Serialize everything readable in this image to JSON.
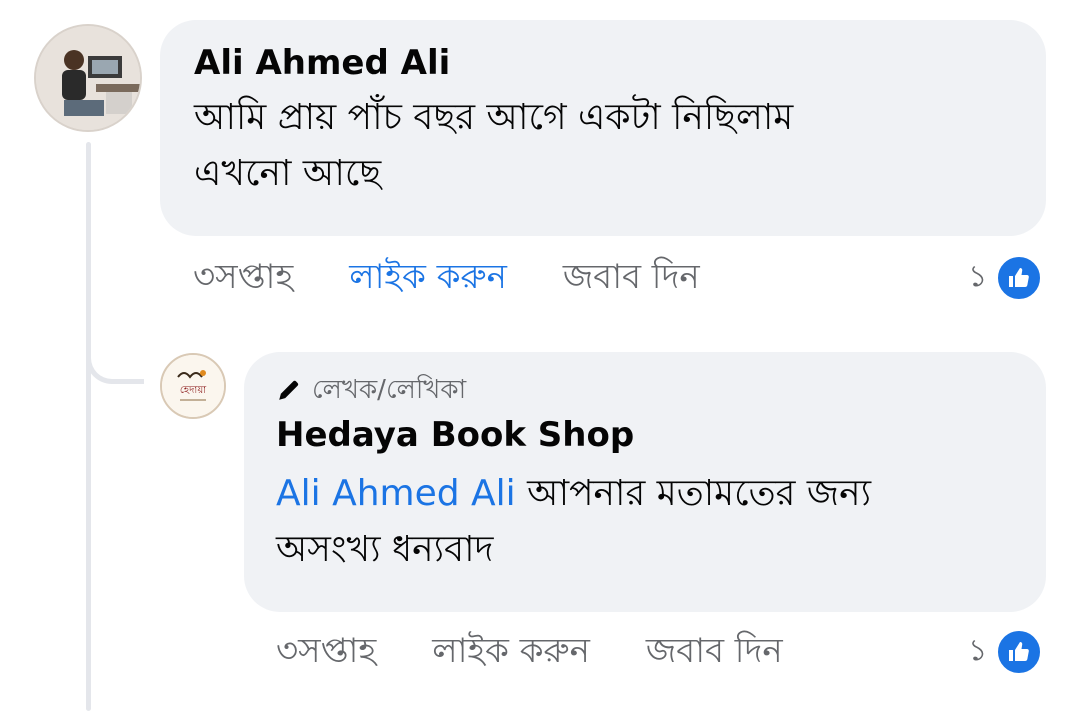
{
  "comment": {
    "author": "Ali Ahmed Ali",
    "text_line1": "আমি প্রায় পাঁচ বছর আগে একটা নিছিলাম",
    "text_line2": "এখনো আছে",
    "time": "৩সপ্তাহ",
    "like_label": "লাইক করুন",
    "reply_label": "জবাব দিন",
    "reaction_count": "১"
  },
  "reply": {
    "badge_label": "লেখক/লেখিকা",
    "author": "Hedaya Book Shop",
    "mention": "Ali Ahmed Ali",
    "text_line1": "আপনার মতামতের জন্য",
    "text_line2": "অসংখ্য ধন্যবাদ",
    "avatar_logo_text": "হেদায়া",
    "time": "৩সপ্তাহ",
    "like_label": "লাইক করুন",
    "reply_label": "জবাব দিন",
    "reaction_count": "১"
  },
  "colors": {
    "accent": "#1b74e4",
    "bubble": "#f0f2f5",
    "muted": "#65676b"
  },
  "icons": [
    "pencil-icon",
    "thumbs-up-icon"
  ]
}
